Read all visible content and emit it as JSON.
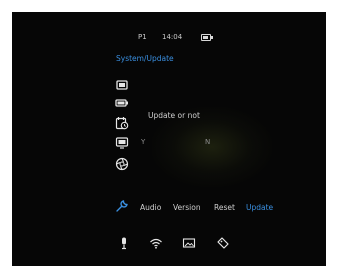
{
  "status": {
    "profile": "P1",
    "time": "14:04"
  },
  "title": "System/Update",
  "side_icons": [
    "display-icon",
    "battery-icon",
    "clock-icon",
    "screen-icon",
    "aperture-icon",
    "wrench-icon"
  ],
  "dialog": {
    "question": "Update or not",
    "yes": "Y",
    "no": "N"
  },
  "tabs": [
    "Audio",
    "Version",
    "Reset",
    "Update"
  ],
  "active_tab": "Update",
  "bottom_icons": [
    "microphone-icon",
    "wifi-icon",
    "picture-icon",
    "tag-icon"
  ],
  "colors": {
    "accent": "#3a8fe0",
    "text": "#cfcfcf",
    "background": "#060606"
  }
}
